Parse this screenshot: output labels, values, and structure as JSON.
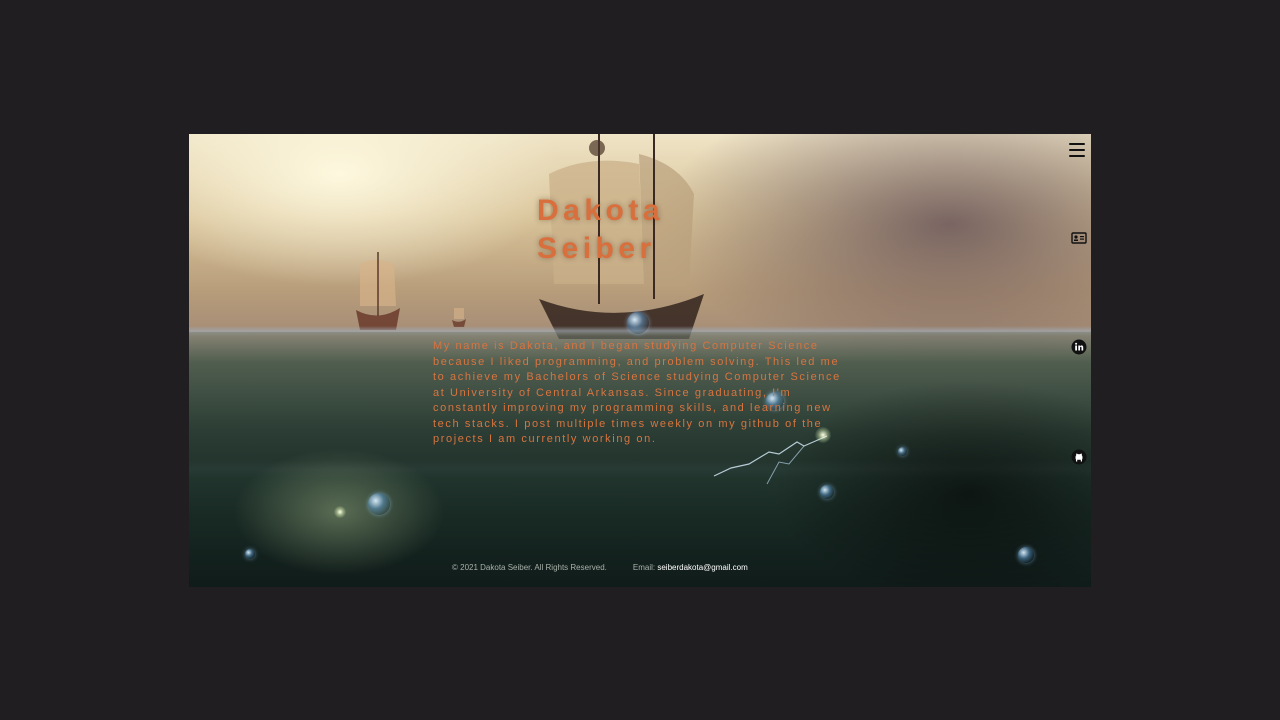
{
  "hero": {
    "first_name": "Dakota",
    "last_name": "Seiber",
    "bio": "My name is Dakota, and I began studying Computer Science because I liked programming, and problem solving. This led me to achieve my Bachelors of Science studying Computer Science at University of Central Arkansas. Since graduating, I'm constantly improving my programming skills, and learning new tech stacks. I post multiple times weekly on my github of the projects I am currently working on."
  },
  "footer": {
    "copyright": "© 2021 Dakota Seiber. All Rights Reserved.",
    "email_label": "Email:",
    "email": "seiberdakota@gmail.com"
  },
  "icons": {
    "menu": "hamburger-menu-icon",
    "resume": "resume-card-icon",
    "linkedin": "linkedin-icon",
    "github": "github-icon"
  },
  "colors": {
    "page_background": "#201e21",
    "accent_text": "#d86f3c",
    "footer_text": "#a8b0aa",
    "email_link": "#ffffff"
  }
}
